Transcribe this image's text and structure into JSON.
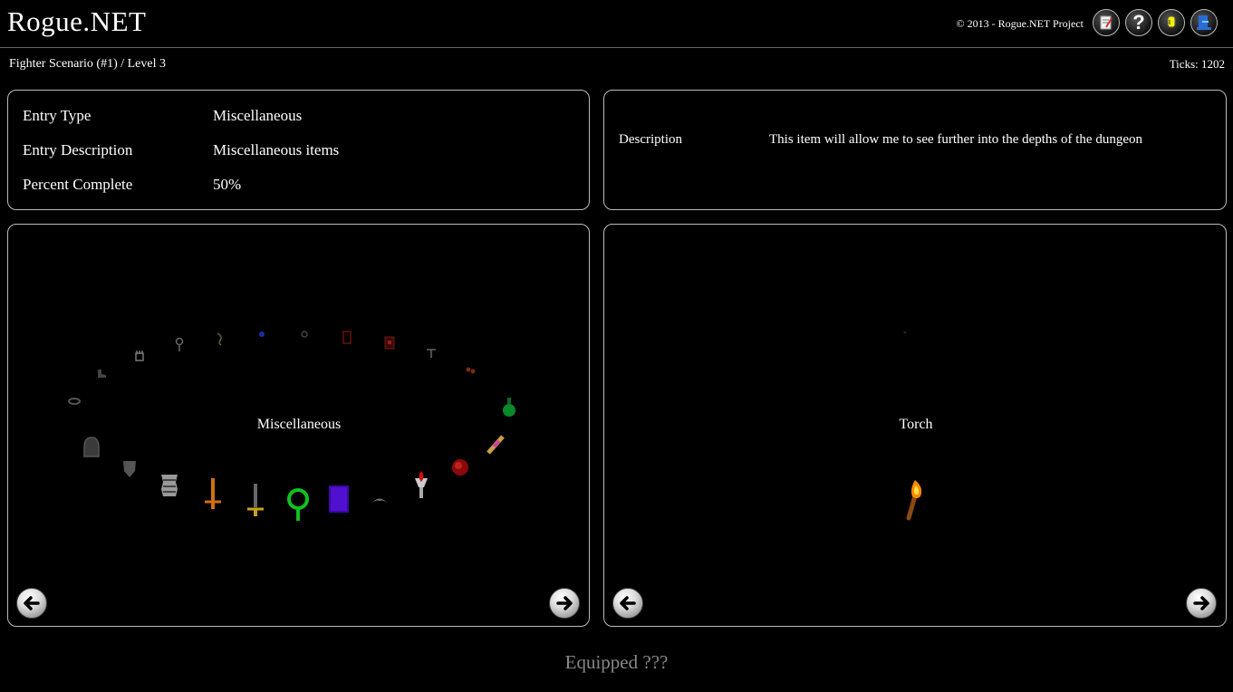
{
  "app": {
    "title": "Rogue.NET",
    "copyright": "© 2013 - Rogue.NET Project"
  },
  "toolbar": {
    "buttons": [
      {
        "icon": "scroll-icon"
      },
      {
        "icon": "help-icon",
        "glyph": "?"
      },
      {
        "icon": "lightbulb-icon"
      },
      {
        "icon": "exit-icon"
      }
    ]
  },
  "status": {
    "breadcrumb": "Fighter Scenario (#1) / Level 3",
    "ticks": "Ticks: 1202"
  },
  "entry": {
    "type_label": "Entry Type",
    "type_value": "Miscellaneous",
    "description_label": "Entry Description",
    "description_value": "Miscellaneous items",
    "percent_label": "Percent Complete",
    "percent_value": "50%"
  },
  "detail": {
    "description_label": "Description",
    "description_value": "This item will allow me to see further into the depths of the dungeon"
  },
  "category_carousel": {
    "label": "Miscellaneous"
  },
  "item_carousel": {
    "label": "Torch"
  },
  "footer": {
    "equipped": "Equipped ???"
  }
}
